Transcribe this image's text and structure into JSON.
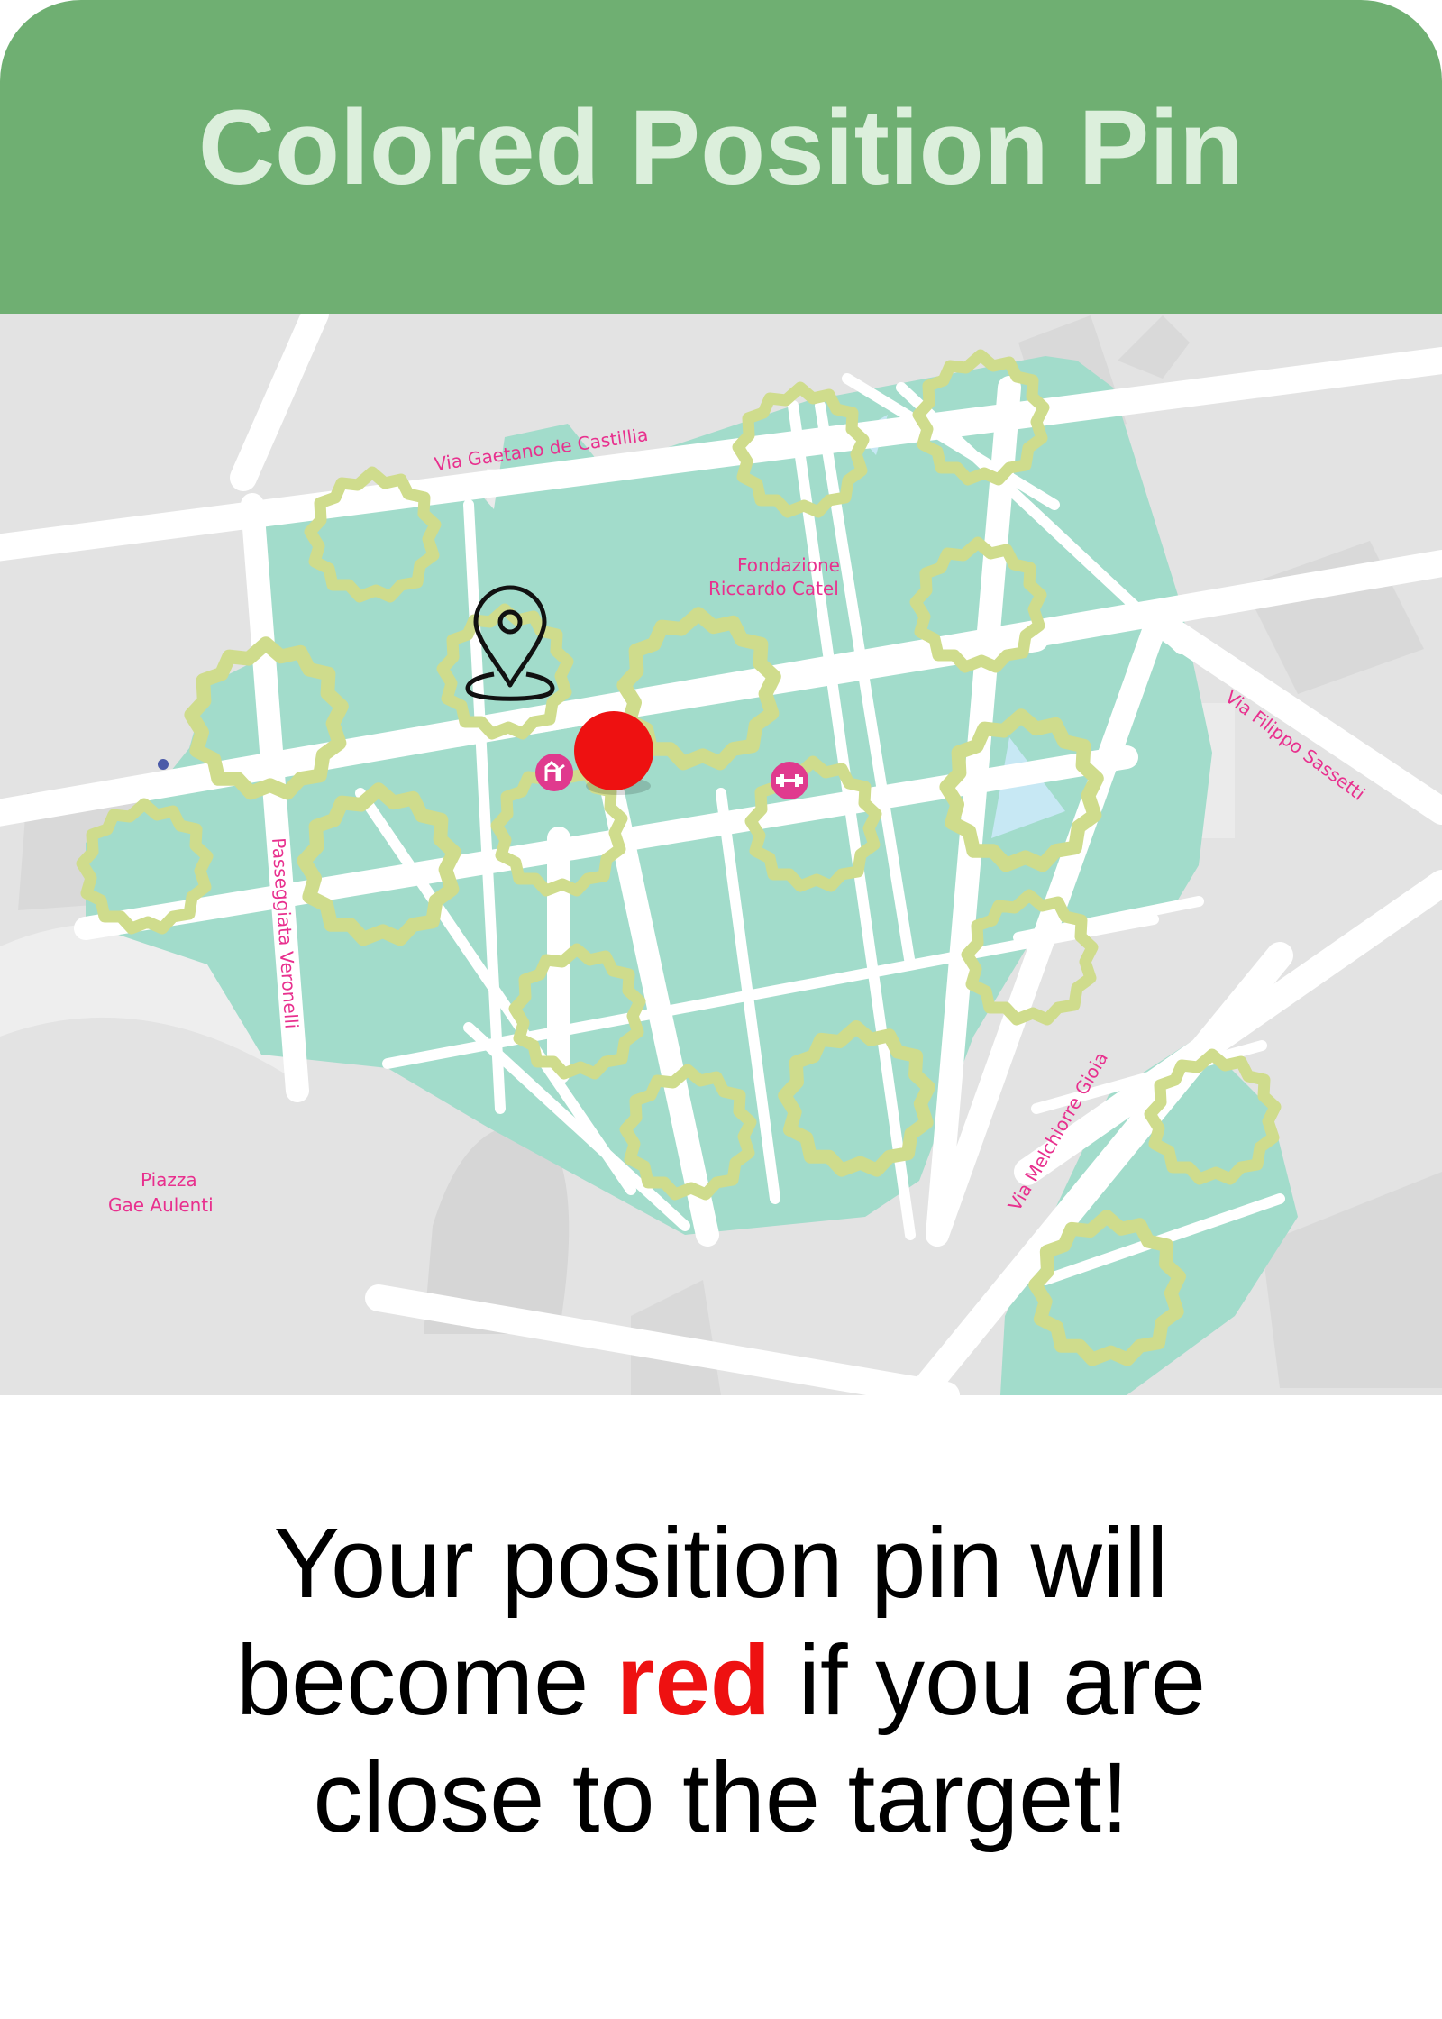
{
  "title": "Colored Position Pin",
  "map": {
    "labels": {
      "via_castillia": "Via Gaetano de Castillia",
      "fondazione_1": "Fondazione",
      "fondazione_2": "Riccardo Catel",
      "via_sassetti": "Via Filippo Sassetti",
      "passeggiata": "Passeggiata Veronelli",
      "piazza_1": "Piazza",
      "piazza_2": "Gae Aulenti",
      "via_gioia": "Via Melchiorre Gioia"
    },
    "colors": {
      "park": "#a2dccb",
      "road": "#ffffff",
      "ground": "#e3e3e3",
      "target_ring": "#cfdc8c",
      "label": "#e8308e",
      "user_pin": "#ee1111"
    },
    "icons": [
      "location-pin-icon",
      "playground-icon",
      "gym-icon"
    ]
  },
  "caption": {
    "line1": "Your position pin will",
    "line2_before": "become ",
    "line2_highlight": "red",
    "line2_after": " if you are",
    "line3": "close to the target!"
  }
}
